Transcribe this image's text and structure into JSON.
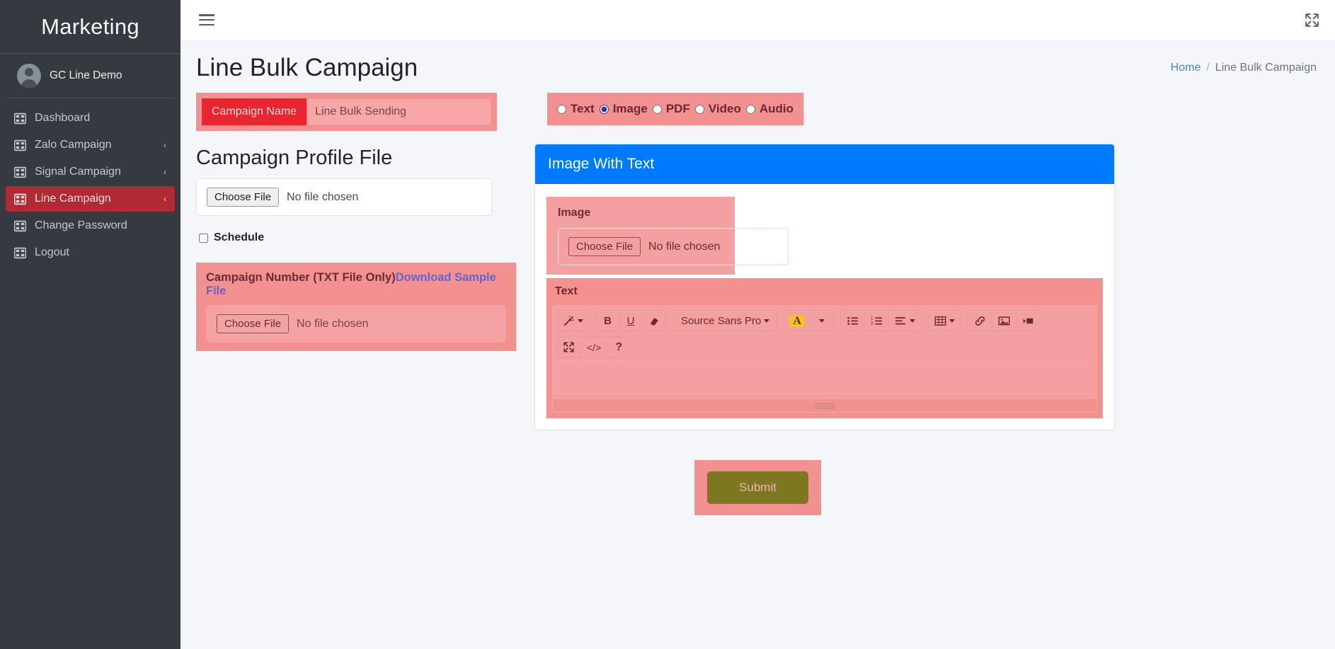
{
  "sidebar": {
    "brand": "Marketing",
    "user": {
      "name": "GC Line Demo",
      "avatar_icon": "user-avatar-icon"
    },
    "items": [
      {
        "label": "Dashboard",
        "icon": "table-grid-icon",
        "caret": "",
        "active": false
      },
      {
        "label": "Zalo Campaign",
        "icon": "table-grid-icon",
        "caret": "‹",
        "active": false
      },
      {
        "label": "Signal Campaign",
        "icon": "table-grid-icon",
        "caret": "‹",
        "active": false
      },
      {
        "label": "Line Campaign",
        "icon": "table-grid-icon",
        "caret": "‹",
        "active": true
      },
      {
        "label": "Change Password",
        "icon": "table-grid-icon",
        "caret": "",
        "active": false
      },
      {
        "label": "Logout",
        "icon": "table-grid-icon",
        "caret": "",
        "active": false
      }
    ]
  },
  "topbar": {
    "menu_icon": "hamburger-menu-icon",
    "fullscreen_icon": "expand-arrows-icon"
  },
  "header": {
    "page_title": "Line Bulk Campaign",
    "breadcrumb": {
      "home": "Home",
      "separator": "/",
      "current": "Line Bulk Campaign"
    }
  },
  "form": {
    "campaign_name": {
      "label": "Campaign Name",
      "value": "",
      "placeholder": "Line Bulk Sending"
    },
    "media_type": {
      "options": [
        "Text",
        "Image",
        "PDF",
        "Video",
        "Audio"
      ],
      "selected": "Image"
    },
    "profile_file": {
      "title": "Campaign Profile File",
      "choose_button": "Choose File",
      "status": "No file chosen"
    },
    "schedule": {
      "label": "Schedule",
      "checked": false
    },
    "campaign_number": {
      "title": "Campaign Number (TXT File Only)",
      "download_link": "Download Sample File",
      "choose_button": "Choose File",
      "status": "No file chosen"
    },
    "submit": {
      "label": "Submit"
    }
  },
  "card": {
    "title": "Image With Text",
    "image": {
      "label": "Image",
      "choose_button": "Choose File",
      "status": "No file chosen"
    },
    "text": {
      "label": "Text",
      "content": "",
      "toolbar_row1": [
        {
          "name": "magic-wand-style-icon",
          "label": "",
          "caret": true
        },
        {
          "name": "bold-icon",
          "label": "B",
          "caret": false
        },
        {
          "name": "underline-icon",
          "label": "U",
          "caret": false
        },
        {
          "name": "eraser-remove-format-icon",
          "label": "",
          "caret": false
        },
        {
          "name": "font-family-dropdown",
          "label": "Source Sans Pro",
          "caret": true
        },
        {
          "name": "font-color-icon",
          "label": "A",
          "caret": false
        },
        {
          "name": "font-color-dropdown",
          "label": "",
          "caret": true
        },
        {
          "name": "unordered-list-icon",
          "label": "",
          "caret": false
        },
        {
          "name": "ordered-list-icon",
          "label": "",
          "caret": false
        },
        {
          "name": "paragraph-align-icon",
          "label": "",
          "caret": true
        },
        {
          "name": "table-icon",
          "label": "",
          "caret": true
        },
        {
          "name": "link-icon",
          "label": "",
          "caret": false
        },
        {
          "name": "picture-icon",
          "label": "",
          "caret": false
        },
        {
          "name": "video-icon",
          "label": "",
          "caret": false
        }
      ],
      "toolbar_row2": [
        {
          "name": "fullscreen-icon",
          "label": "",
          "caret": false
        },
        {
          "name": "code-view-icon",
          "label": "</>",
          "caret": false
        },
        {
          "name": "help-icon",
          "label": "?",
          "caret": false
        }
      ]
    }
  },
  "colors": {
    "sidebar_bg": "#343a40",
    "active_nav": "#b02a33",
    "accent_red": "#e82630",
    "highlight_pink": "#f2918f",
    "card_header_blue": "#007bff",
    "submit_olive": "#7d7722",
    "link_purple": "#6c63c8",
    "breadcrumb_blue": "#4285c8"
  }
}
